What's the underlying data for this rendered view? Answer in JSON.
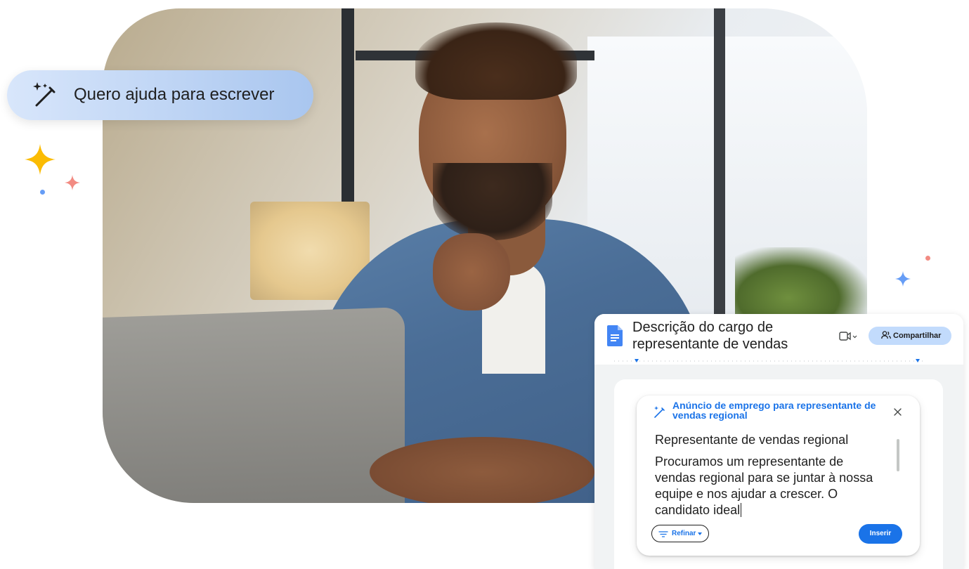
{
  "chip": {
    "label": "Quero ajuda para escrever",
    "icon": "magic-wand-icon"
  },
  "docs": {
    "title": "Descrição do cargo de representante de vendas",
    "share_label": "Compartilhar",
    "icons": [
      "docs-icon",
      "meet-icon",
      "share-icon"
    ]
  },
  "help_me_write": {
    "title": "Anúncio de emprego para representante de vendas regional",
    "heading": "Representante de vendas regional",
    "body": "Procuramos um representante de vendas regional para se juntar à nossa equipe e nos ajudar a crescer. O candidato ideal",
    "refine_label": "Refinar",
    "insert_label": "Inserir"
  },
  "colors": {
    "accent": "#1a73e8",
    "chip_gradient_start": "#d8e6fb",
    "chip_gradient_end": "#a9c6ef",
    "share_bg": "#c2dbfc",
    "sparkle_yellow": "#fbbc04",
    "sparkle_pink": "#f28b82",
    "sparkle_blue": "#669df6"
  }
}
